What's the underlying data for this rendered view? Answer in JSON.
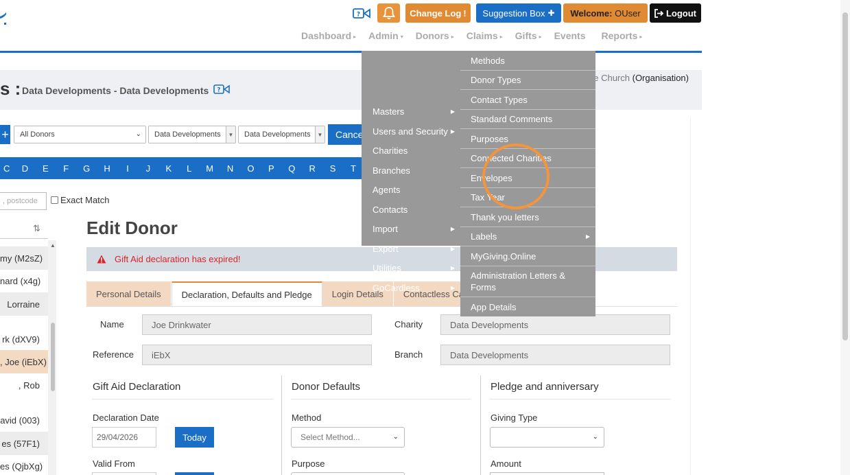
{
  "header": {
    "changelog_label": "Change Log",
    "changelog_mark": "!",
    "suggestion_label": "Suggestion Box",
    "suggestion_mark": "✚",
    "welcome_label": "Welcome:",
    "welcome_user": "OUser",
    "logout_label": "Logout"
  },
  "nav": [
    {
      "label": "Dashboard",
      "caret": "▸"
    },
    {
      "label": "Admin",
      "caret": "▾"
    },
    {
      "label": "Donors",
      "caret": "▸"
    },
    {
      "label": "Claims",
      "caret": "▸"
    },
    {
      "label": "Gifts",
      "caret": "▸"
    },
    {
      "label": "Events",
      "caret": ""
    },
    {
      "label": "Reports",
      "caret": "▸"
    }
  ],
  "page": {
    "title_prefix": "s :",
    "title": "Data Developments - Data Developments",
    "org_name": "pe Church",
    "org_type": "(Organisation)"
  },
  "filters": {
    "add_label": "+",
    "donor_filter": "All Donors",
    "charity_filter": "Data Developments",
    "branch_filter": "Data Developments",
    "cancel_label": "Cancel"
  },
  "alphabet": [
    "C",
    "D",
    "E",
    "F",
    "G",
    "H",
    "I",
    "J",
    "K",
    "L",
    "M",
    "N",
    "O",
    "P",
    "Q",
    "R",
    "S",
    "T"
  ],
  "search": {
    "placeholder": ", postcode",
    "exact_match_label": "Exact Match"
  },
  "donor_list": [
    {
      "label": "my (M2sZ)",
      "style": "alt"
    },
    {
      "label": "nard (x4g)",
      "style": "plain"
    },
    {
      "label": "Lorraine",
      "style": "alt"
    },
    {
      "label": "rk (dXV9)",
      "style": "plain"
    },
    {
      "label": ", Joe (iEbX)",
      "style": "selected"
    },
    {
      "label": ", Rob",
      "style": "plain"
    },
    {
      "label": "avid (003)",
      "style": "plain"
    },
    {
      "label": "es (57F1)",
      "style": "alt"
    },
    {
      "label": "es (QjbXg)",
      "style": "plain"
    }
  ],
  "form": {
    "title": "Edit Donor",
    "alert": "Gift Aid declaration has expired!",
    "tabs": [
      {
        "label": "Personal Details",
        "active": false
      },
      {
        "label": "Declaration, Defaults and Pledge",
        "active": true
      },
      {
        "label": "Login Details",
        "active": false
      },
      {
        "label": "Contactless Card",
        "active": false
      }
    ],
    "name_label": "Name",
    "name_value": "Joe Drinkwater",
    "reference_label": "Reference",
    "reference_value": "iEbX",
    "charity_label": "Charity",
    "charity_value": "Data Developments",
    "branch_label": "Branch",
    "branch_value": "Data Developments",
    "gift_aid_title": "Gift Aid Declaration",
    "declaration_date_label": "Declaration Date",
    "declaration_date_value": "29/04/2026",
    "today_label": "Today",
    "valid_from_label": "Valid From",
    "donor_defaults_title": "Donor Defaults",
    "method_label": "Method",
    "method_value": "Select Method...",
    "purpose_label": "Purpose",
    "pledge_title": "Pledge and anniversary",
    "giving_type_label": "Giving Type",
    "giving_type_value": "",
    "amount_label": "Amount"
  },
  "admin_menu": {
    "col1": [
      {
        "label": "Masters",
        "sub": true
      },
      {
        "label": "Users and Security",
        "sub": true
      },
      {
        "label": "Charities",
        "sub": false
      },
      {
        "label": "Branches",
        "sub": false
      },
      {
        "label": "Agents",
        "sub": false
      },
      {
        "label": "Contacts",
        "sub": false
      },
      {
        "label": "Import",
        "sub": true
      },
      {
        "label": "Export",
        "sub": true
      },
      {
        "label": "Utilities",
        "sub": true
      },
      {
        "label": "GoCardless",
        "sub": true
      }
    ],
    "col2": [
      {
        "label": "Methods",
        "sub": false
      },
      {
        "label": "Donor Types",
        "sub": false
      },
      {
        "label": "Contact Types",
        "sub": false
      },
      {
        "label": "Standard Comments",
        "sub": false
      },
      {
        "label": "Purposes",
        "sub": false
      },
      {
        "label": "Connected Charities",
        "sub": false
      },
      {
        "label": "Envelopes",
        "sub": false
      },
      {
        "label": "Tax Year",
        "sub": false
      },
      {
        "label": "Thank you letters",
        "sub": false
      },
      {
        "label": "Labels",
        "sub": true
      },
      {
        "label": "MyGiving.Online",
        "sub": false
      },
      {
        "label": "Administration Letters & Forms",
        "sub": false
      },
      {
        "label": "App Details",
        "sub": false
      }
    ]
  },
  "colors": {
    "brand_blue": "#1a6ec6",
    "accent_orange": "#e08a34",
    "menu_grey": "#999999",
    "alert_red": "#d9242a"
  }
}
